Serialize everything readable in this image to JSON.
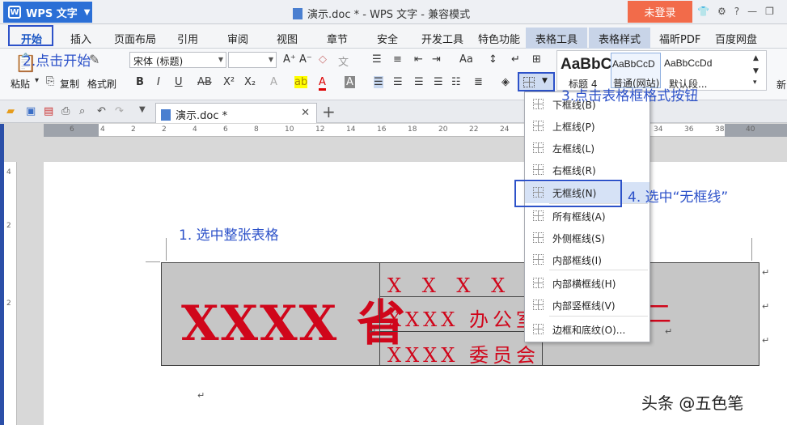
{
  "titlebar": {
    "app_button": "WPS 文字",
    "title": "演示.doc * - WPS 文字 - 兼容模式",
    "login": "未登录"
  },
  "menu_tabs": [
    "开始",
    "插入",
    "页面布局",
    "引用",
    "审阅",
    "视图",
    "章节",
    "安全",
    "开发工具",
    "特色功能",
    "表格工具",
    "表格样式",
    "福昕PDF",
    "百度网盘"
  ],
  "ribbon": {
    "paste": "粘贴",
    "copy": "复制",
    "format_painter": "格式刷",
    "font_name": "宋体 (标题)",
    "font_size": "",
    "styles": [
      {
        "preview": "AaBbC",
        "name": "标题 4"
      },
      {
        "preview": "AaBbCcD",
        "name": "普通(网站)"
      },
      {
        "preview": "AaBbCcDd",
        "name": "默认段..."
      }
    ],
    "new_style": "新"
  },
  "doc_tab": {
    "name": "演示.doc *"
  },
  "ruler": {
    "h_labels": [
      "6",
      "4",
      "2",
      "2",
      "4",
      "6",
      "8",
      "10",
      "12",
      "14",
      "16",
      "18",
      "20",
      "22",
      "24",
      "26",
      "28",
      "30",
      "32",
      "34",
      "36",
      "38",
      "40"
    ],
    "v_labels": [
      "4",
      "2",
      "2"
    ]
  },
  "document": {
    "big_text": "XXXX 省",
    "rows": [
      "X X X X 局",
      "XXXX 办公室",
      "XXXX 委员会"
    ],
    "partial_char": "二"
  },
  "dropdown": {
    "items": [
      "下框线(B)",
      "上框线(P)",
      "左框线(L)",
      "右框线(R)",
      "无框线(N)",
      "所有框线(A)",
      "外侧框线(S)",
      "内部框线(I)",
      "内部横框线(H)",
      "内部竖框线(V)",
      "边框和底纹(O)..."
    ],
    "highlighted": "无框线(N)"
  },
  "annotations": {
    "step1": "1. 选中整张表格",
    "step2": "2.点击开始",
    "step3": "3.点击表格框格式按钮",
    "step4": "4. 选中“无框线”"
  },
  "watermark": "头条 @五色笔",
  "colors": {
    "accent": "#2d52c9",
    "wps_blue": "#2b6fd6",
    "login_orange": "#f26b4a",
    "table_fill": "#c6c6c6",
    "doc_red": "#d0061b"
  }
}
